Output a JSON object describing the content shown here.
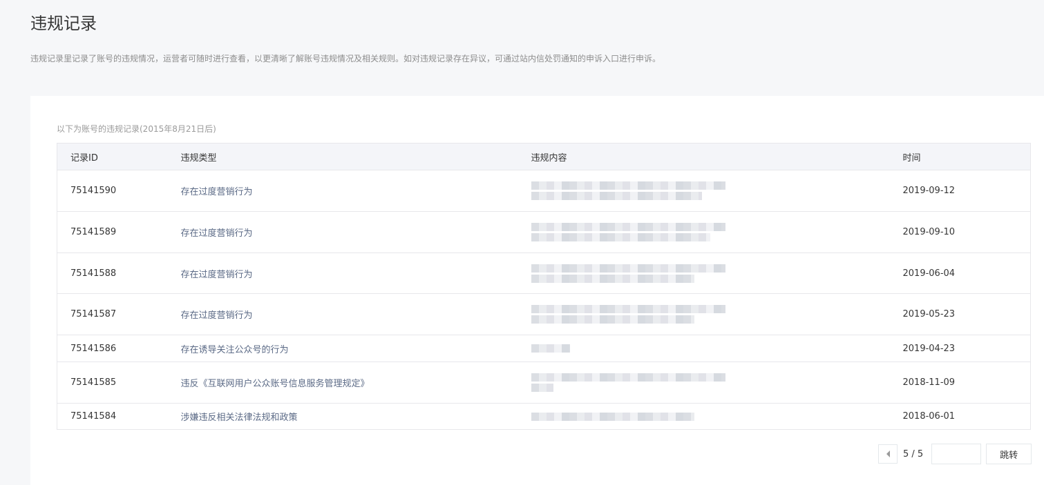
{
  "header": {
    "title": "违规记录",
    "description": "违规记录里记录了账号的违规情况，运营者可随时进行查看，以更清晰了解账号违规情况及相关规则。如对违规记录存在异议，可通过站内信处罚通知的申诉入口进行申诉。"
  },
  "records": {
    "note": "以下为账号的违规记录(2015年8月21日后)",
    "columns": [
      "记录ID",
      "违规类型",
      "违规内容",
      "时间"
    ],
    "rows": [
      {
        "id": "75141590",
        "type": "存在过度营销行为",
        "time": "2019-09-12"
      },
      {
        "id": "75141589",
        "type": "存在过度营销行为",
        "time": "2019-09-10"
      },
      {
        "id": "75141588",
        "type": "存在过度营销行为",
        "time": "2019-06-04"
      },
      {
        "id": "75141587",
        "type": "存在过度营销行为",
        "time": "2019-05-23"
      },
      {
        "id": "75141586",
        "type": "存在诱导关注公众号的行为",
        "time": "2019-04-23"
      },
      {
        "id": "75141585",
        "type": "违反《互联网用户公众账号信息服务管理规定》",
        "time": "2018-11-09"
      },
      {
        "id": "75141584",
        "type": "涉嫌违反相关法律法规和政策",
        "time": "2018-06-01"
      }
    ]
  },
  "pagination": {
    "indicator": "5 / 5",
    "jump_label": "跳转",
    "input_value": ""
  },
  "icons": {
    "prev": "triangle-left-icon"
  }
}
